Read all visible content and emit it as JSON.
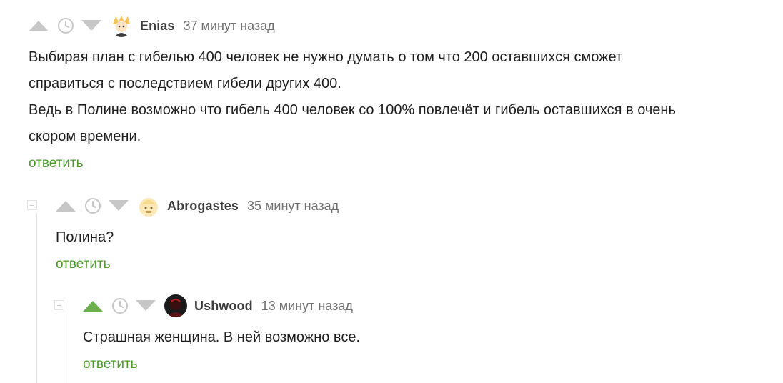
{
  "comments": [
    {
      "author": "Enias",
      "time": "37 минут назад",
      "text": "Выбирая план с гибелью 400 человек не нужно думать о том что 200 оставшихся сможет\nсправиться с последствием гибели других 400.\nВедь в Полине возможно что гибель 400 человек со 100% повлечёт и гибель оставшихся в очень\nскором времени.",
      "reply_label": "ответить",
      "upvoted": false
    },
    {
      "author": "Abrogastes",
      "time": "35 минут назад",
      "text": "Полина?",
      "reply_label": "ответить",
      "upvoted": false
    },
    {
      "author": "Ushwood",
      "time": "13 минут назад",
      "text": "Страшная женщина. В ней возможно все.",
      "reply_label": "ответить",
      "upvoted": true
    }
  ],
  "colors": {
    "vote_inactive": "#c7c7c7",
    "vote_active": "#6ab04c",
    "reply_link": "#4a9a2a"
  }
}
